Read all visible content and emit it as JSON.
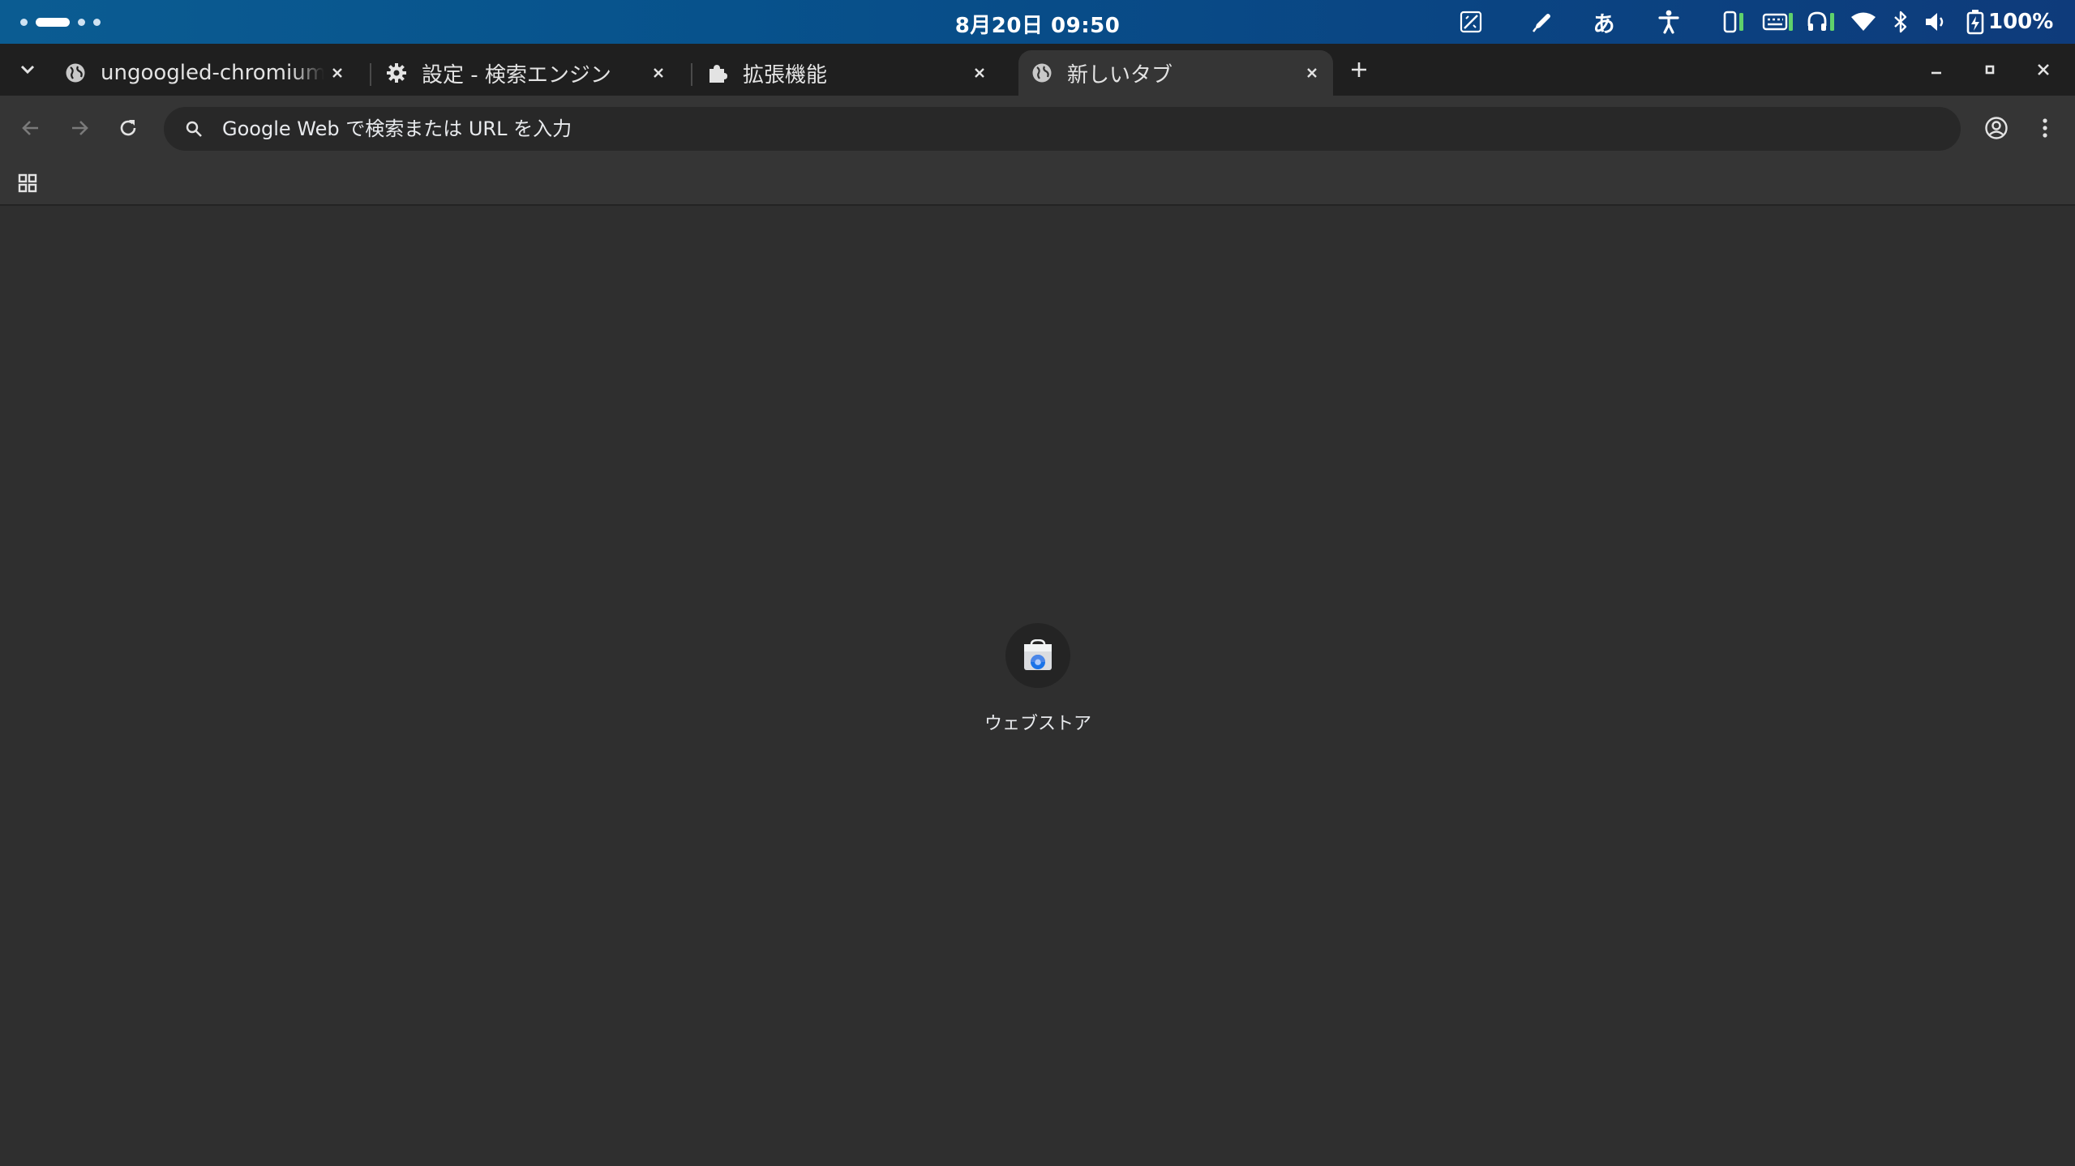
{
  "system_bar": {
    "clock": "8月20日  09:50",
    "ime_label": "あ",
    "battery_label": "100%",
    "icons": [
      "workspace-dots",
      "pen-off-icon",
      "stylus-icon",
      "ime-icon",
      "accessibility-icon",
      "phone-icon",
      "keyboard-icon",
      "headset-icon",
      "wifi-icon",
      "bluetooth-icon",
      "volume-icon",
      "battery-icon"
    ],
    "colors": {
      "bar_gradient_start": "#0b5c92",
      "bar_gradient_end": "#0e3b7b",
      "indicator_green": "#5fd16b"
    }
  },
  "tabs": [
    {
      "title": "ungoogled-chromium fl",
      "icon": "globe-icon",
      "active": false
    },
    {
      "title": "設定 - 検索エンジン",
      "icon": "gear-icon",
      "active": false
    },
    {
      "title": "拡張機能",
      "icon": "puzzle-icon",
      "active": false
    },
    {
      "title": "新しいタブ",
      "icon": "globe-icon",
      "active": true
    }
  ],
  "omnibox": {
    "placeholder": "Google Web で検索または URL を入力",
    "value": ""
  },
  "shortcuts": [
    {
      "label": "ウェブストア",
      "icon": "webstore-icon"
    }
  ],
  "theme": {
    "tabstrip_bg": "#1f1f1f",
    "toolbar_bg": "#353535",
    "page_bg": "#2f2f2f",
    "omnibox_bg": "#282828"
  }
}
